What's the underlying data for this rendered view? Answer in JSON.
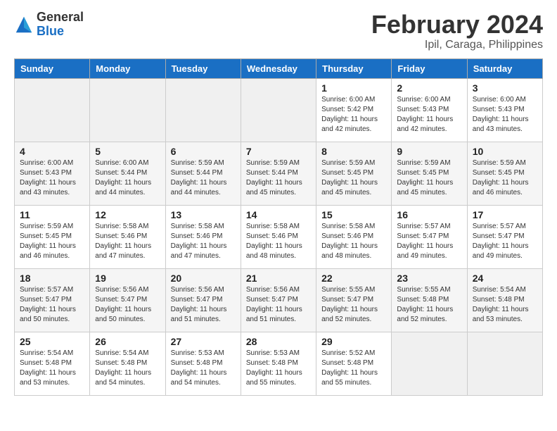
{
  "header": {
    "logo_general": "General",
    "logo_blue": "Blue",
    "month_title": "February 2024",
    "location": "Ipil, Caraga, Philippines"
  },
  "days_of_week": [
    "Sunday",
    "Monday",
    "Tuesday",
    "Wednesday",
    "Thursday",
    "Friday",
    "Saturday"
  ],
  "weeks": [
    [
      {
        "day": "",
        "info": ""
      },
      {
        "day": "",
        "info": ""
      },
      {
        "day": "",
        "info": ""
      },
      {
        "day": "",
        "info": ""
      },
      {
        "day": "1",
        "info": "Sunrise: 6:00 AM\nSunset: 5:42 PM\nDaylight: 11 hours\nand 42 minutes."
      },
      {
        "day": "2",
        "info": "Sunrise: 6:00 AM\nSunset: 5:43 PM\nDaylight: 11 hours\nand 42 minutes."
      },
      {
        "day": "3",
        "info": "Sunrise: 6:00 AM\nSunset: 5:43 PM\nDaylight: 11 hours\nand 43 minutes."
      }
    ],
    [
      {
        "day": "4",
        "info": "Sunrise: 6:00 AM\nSunset: 5:43 PM\nDaylight: 11 hours\nand 43 minutes."
      },
      {
        "day": "5",
        "info": "Sunrise: 6:00 AM\nSunset: 5:44 PM\nDaylight: 11 hours\nand 44 minutes."
      },
      {
        "day": "6",
        "info": "Sunrise: 5:59 AM\nSunset: 5:44 PM\nDaylight: 11 hours\nand 44 minutes."
      },
      {
        "day": "7",
        "info": "Sunrise: 5:59 AM\nSunset: 5:44 PM\nDaylight: 11 hours\nand 45 minutes."
      },
      {
        "day": "8",
        "info": "Sunrise: 5:59 AM\nSunset: 5:45 PM\nDaylight: 11 hours\nand 45 minutes."
      },
      {
        "day": "9",
        "info": "Sunrise: 5:59 AM\nSunset: 5:45 PM\nDaylight: 11 hours\nand 45 minutes."
      },
      {
        "day": "10",
        "info": "Sunrise: 5:59 AM\nSunset: 5:45 PM\nDaylight: 11 hours\nand 46 minutes."
      }
    ],
    [
      {
        "day": "11",
        "info": "Sunrise: 5:59 AM\nSunset: 5:45 PM\nDaylight: 11 hours\nand 46 minutes."
      },
      {
        "day": "12",
        "info": "Sunrise: 5:58 AM\nSunset: 5:46 PM\nDaylight: 11 hours\nand 47 minutes."
      },
      {
        "day": "13",
        "info": "Sunrise: 5:58 AM\nSunset: 5:46 PM\nDaylight: 11 hours\nand 47 minutes."
      },
      {
        "day": "14",
        "info": "Sunrise: 5:58 AM\nSunset: 5:46 PM\nDaylight: 11 hours\nand 48 minutes."
      },
      {
        "day": "15",
        "info": "Sunrise: 5:58 AM\nSunset: 5:46 PM\nDaylight: 11 hours\nand 48 minutes."
      },
      {
        "day": "16",
        "info": "Sunrise: 5:57 AM\nSunset: 5:47 PM\nDaylight: 11 hours\nand 49 minutes."
      },
      {
        "day": "17",
        "info": "Sunrise: 5:57 AM\nSunset: 5:47 PM\nDaylight: 11 hours\nand 49 minutes."
      }
    ],
    [
      {
        "day": "18",
        "info": "Sunrise: 5:57 AM\nSunset: 5:47 PM\nDaylight: 11 hours\nand 50 minutes."
      },
      {
        "day": "19",
        "info": "Sunrise: 5:56 AM\nSunset: 5:47 PM\nDaylight: 11 hours\nand 50 minutes."
      },
      {
        "day": "20",
        "info": "Sunrise: 5:56 AM\nSunset: 5:47 PM\nDaylight: 11 hours\nand 51 minutes."
      },
      {
        "day": "21",
        "info": "Sunrise: 5:56 AM\nSunset: 5:47 PM\nDaylight: 11 hours\nand 51 minutes."
      },
      {
        "day": "22",
        "info": "Sunrise: 5:55 AM\nSunset: 5:47 PM\nDaylight: 11 hours\nand 52 minutes."
      },
      {
        "day": "23",
        "info": "Sunrise: 5:55 AM\nSunset: 5:48 PM\nDaylight: 11 hours\nand 52 minutes."
      },
      {
        "day": "24",
        "info": "Sunrise: 5:54 AM\nSunset: 5:48 PM\nDaylight: 11 hours\nand 53 minutes."
      }
    ],
    [
      {
        "day": "25",
        "info": "Sunrise: 5:54 AM\nSunset: 5:48 PM\nDaylight: 11 hours\nand 53 minutes."
      },
      {
        "day": "26",
        "info": "Sunrise: 5:54 AM\nSunset: 5:48 PM\nDaylight: 11 hours\nand 54 minutes."
      },
      {
        "day": "27",
        "info": "Sunrise: 5:53 AM\nSunset: 5:48 PM\nDaylight: 11 hours\nand 54 minutes."
      },
      {
        "day": "28",
        "info": "Sunrise: 5:53 AM\nSunset: 5:48 PM\nDaylight: 11 hours\nand 55 minutes."
      },
      {
        "day": "29",
        "info": "Sunrise: 5:52 AM\nSunset: 5:48 PM\nDaylight: 11 hours\nand 55 minutes."
      },
      {
        "day": "",
        "info": ""
      },
      {
        "day": "",
        "info": ""
      }
    ]
  ]
}
